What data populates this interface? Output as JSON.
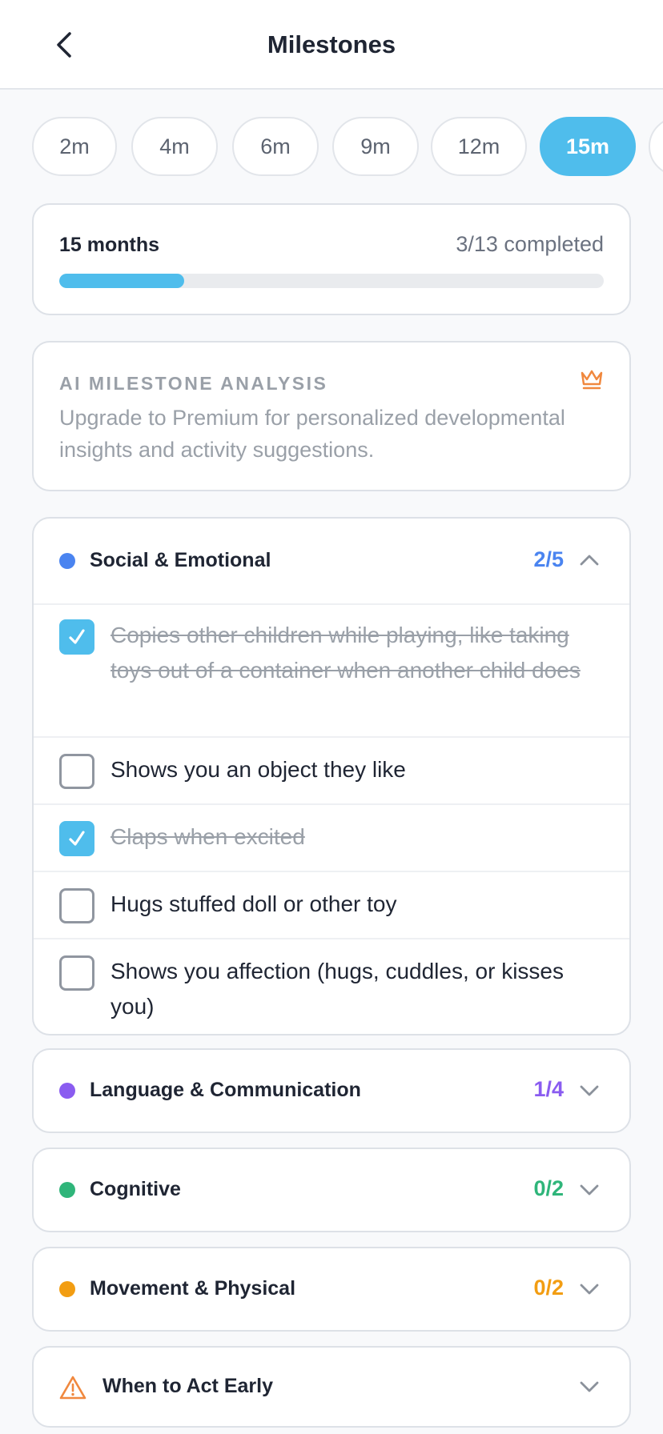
{
  "header": {
    "title": "Milestones"
  },
  "tabs": [
    {
      "label": "2m",
      "active": false
    },
    {
      "label": "4m",
      "active": false
    },
    {
      "label": "6m",
      "active": false
    },
    {
      "label": "9m",
      "active": false
    },
    {
      "label": "12m",
      "active": false
    },
    {
      "label": "15m",
      "active": true
    }
  ],
  "progress": {
    "label": "15 months",
    "count": "3/13 completed",
    "fraction": 0.23
  },
  "ai": {
    "title": "AI MILESTONE ANALYSIS",
    "text": "Upgrade to Premium for personalized developmental insights and activity suggestions.",
    "icon": "crown-icon"
  },
  "sections": {
    "social": {
      "name": "Social & Emotional",
      "count": "2/5",
      "color": "#4a84f0",
      "expanded": true,
      "items": [
        {
          "text": "Copies other children while playing, like taking toys out of a container when another child does",
          "checked": true
        },
        {
          "text": "Shows you an object they like",
          "checked": false
        },
        {
          "text": "Claps when excited",
          "checked": true
        },
        {
          "text": "Hugs stuffed doll or other toy",
          "checked": false
        },
        {
          "text": "Shows you affection (hugs, cuddles, or kisses you)",
          "checked": false
        }
      ]
    },
    "language": {
      "name": "Language & Communication",
      "count": "1/4",
      "color": "#8a5cf0"
    },
    "cognitive": {
      "name": "Cognitive",
      "count": "0/2",
      "color": "#2fb57a"
    },
    "movement": {
      "name": "Movement & Physical",
      "count": "0/2",
      "color": "#f29d12"
    },
    "early": {
      "name": "When to Act Early",
      "color": "#f0883e"
    }
  },
  "colors": {
    "accent": "#4fbdec",
    "muted": "#9aa0a8",
    "premium": "#f0883e"
  }
}
